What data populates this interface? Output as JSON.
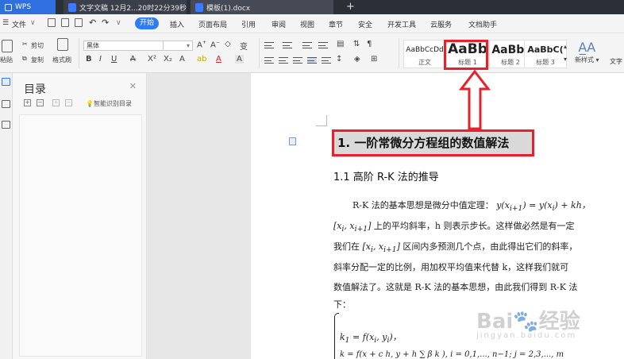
{
  "tabs": {
    "wps": "WPS",
    "doc1": "文字文稿 12月2...20时22分39秒",
    "doc2": "模板(1).docx"
  },
  "menu": {
    "file": "文件",
    "start": "开始",
    "items": [
      "插入",
      "页面布局",
      "引用",
      "审阅",
      "视图",
      "章节",
      "安全",
      "开发工具",
      "云服务",
      "文档助手"
    ]
  },
  "ribbon": {
    "paste": "粘贴",
    "cut": "剪切",
    "copy": "复制",
    "format_painter": "格式刷",
    "font_name": "黑体",
    "font_size": "",
    "new_style": "新样式",
    "text_tools": "文字"
  },
  "styles": [
    {
      "preview": "AaBbCcDd",
      "name": "正文"
    },
    {
      "preview": "AaBb",
      "name": "标题 1"
    },
    {
      "preview": "AaBb(",
      "name": "标题 2"
    },
    {
      "preview": "AaBbC(",
      "name": "标题 3"
    }
  ],
  "toc": {
    "title": "目录",
    "smart_label": "智能识别目录"
  },
  "document": {
    "heading1": "1. 一阶常微分方程组的数值解法",
    "heading2": "1.1 高阶 R-K 法的推导",
    "lines": [
      "R-K 法的基本思想是微分中值定理：",
      "上的平均斜率，h 则表示步长。这样做必然是有一定",
      "我们在",
      "区间内多预测几个点，由此得出它们的斜率，",
      "斜率分配一定的比例，用加权平均值来代替 k，这样我们就可",
      "数值解法了。这就是 R-K 法的基本思想，由此我们得到 R-K 法",
      "下："
    ],
    "formula_main": "y(x",
    "formula_rest": ") = y(x",
    "formula_tail": ") + kh，",
    "interval": "[x",
    "interval_end": "]",
    "k1": "k",
    "k1_rest": " = f(x",
    "k1_tail": ", y",
    "k1_close": ")，",
    "k2_line": "k  = f(x  + c  h, y  + h ∑ β  k  ), i = 0,1,..., n−1; j = 2,3,..., m"
  },
  "watermark": {
    "main": "Bai",
    "tail": "经验",
    "sub": "jingyan.baidu.com"
  },
  "colors": {
    "accent": "#2f7bf5",
    "annotation": "#e8202a",
    "tab_active": "#454a55"
  }
}
